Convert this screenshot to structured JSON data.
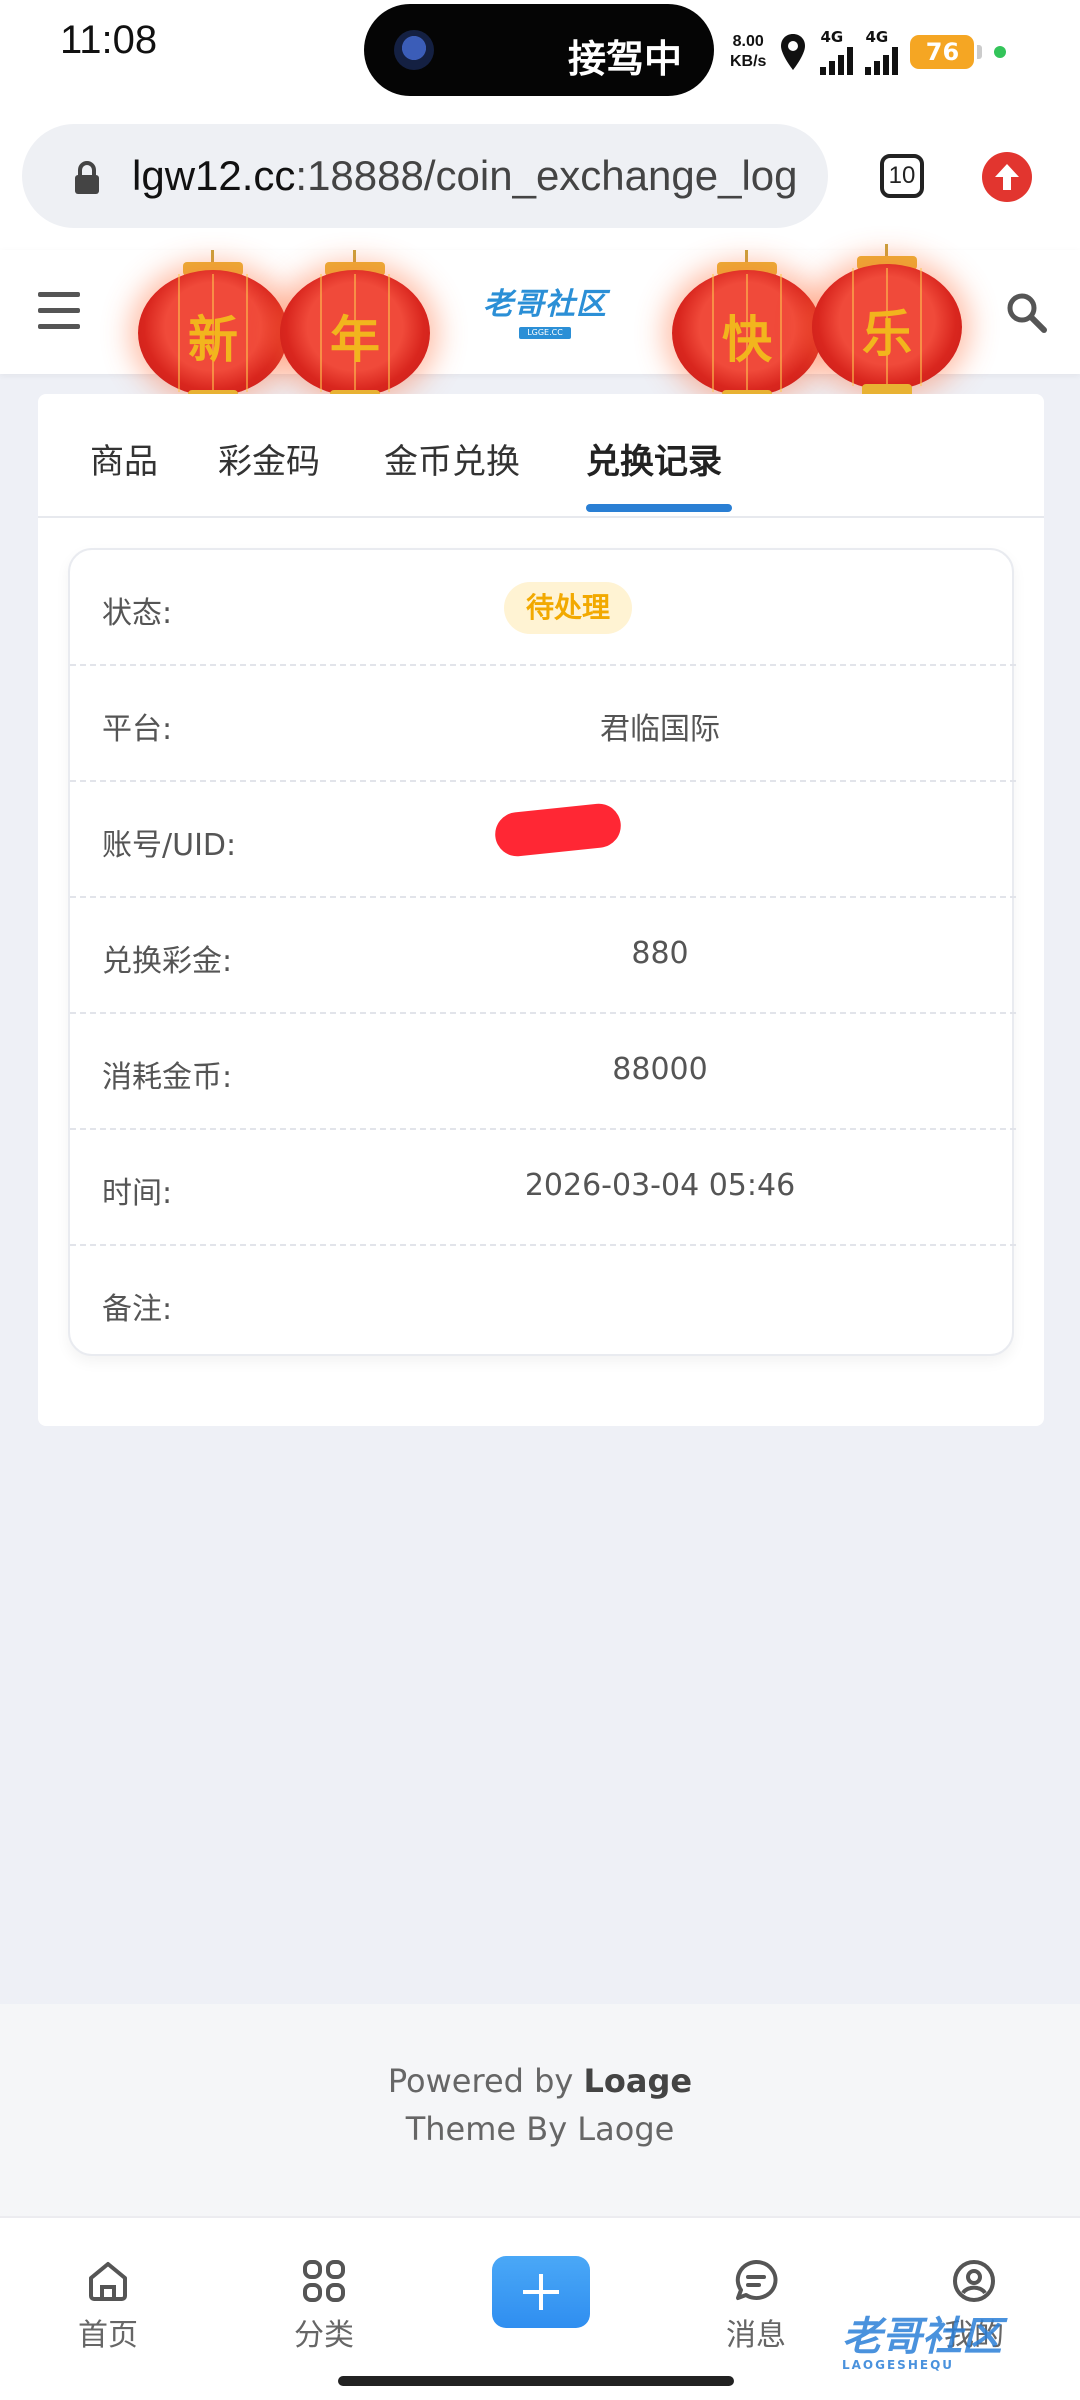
{
  "status_bar": {
    "time": "11:08",
    "island_text": "接驾中",
    "net_speed_value": "8.00",
    "net_speed_unit": "KB/s",
    "sim1_label": "4G",
    "sim2_label": "4G",
    "battery": "76"
  },
  "browser": {
    "url_host": "lgw12.cc",
    "url_path": ":18888/coin_exchange_log",
    "tab_count": "10"
  },
  "header": {
    "lanterns": [
      "新",
      "年",
      "快",
      "乐"
    ],
    "logo_text": "老哥社区",
    "logo_sub": "LGGE.CC"
  },
  "tabs": [
    {
      "label": "商品"
    },
    {
      "label": "彩金码"
    },
    {
      "label": "金币兑换"
    },
    {
      "label": "兑换记录"
    }
  ],
  "record": {
    "status_label": "状态:",
    "status_value": "待处理",
    "platform_label": "平台:",
    "platform_value": "君临国际",
    "account_label": "账号/UID:",
    "amount_label": "兑换彩金:",
    "amount_value": "880",
    "coins_label": "消耗金币:",
    "coins_value": "88000",
    "time_label": "时间:",
    "time_value": "2026-03-04 05:46",
    "note_label": "备注:"
  },
  "footer": {
    "powered_prefix": "Powered by ",
    "powered_brand": "Loage",
    "theme": "Theme By Laoge"
  },
  "nav": {
    "home": "首页",
    "category": "分类",
    "messages": "消息",
    "mine": "我的"
  },
  "watermark": {
    "text": "老哥社区",
    "sub": "LAOGESHEQU"
  },
  "colors": {
    "accent": "#2a7fd4",
    "badge_bg": "#fff3d3",
    "badge_text": "#f2a900",
    "lantern_red": "#d9261e"
  }
}
